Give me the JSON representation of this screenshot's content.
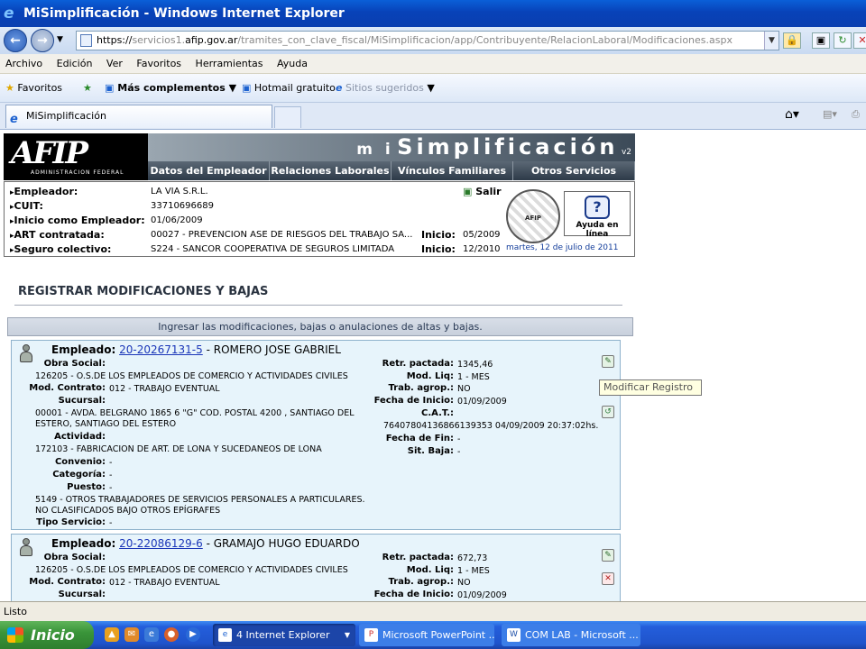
{
  "browser": {
    "title": "MiSimplificación - Windows Internet Explorer",
    "url_https": "https://",
    "url_host_pre": "servicios1.",
    "url_host": "afip.gov.ar",
    "url_path": "/tramites_con_clave_fiscal/MiSimplificacion/app/Contribuyente/RelacionLaboral/Modificaciones.aspx",
    "menu": [
      "Archivo",
      "Edición",
      "Ver",
      "Favoritos",
      "Herramientas",
      "Ayuda"
    ],
    "favorites": {
      "favoritos": "Favoritos",
      "mas": "Más complementos",
      "hotmail": "Hotmail gratuito",
      "sugeridos": "Sitios sugeridos"
    },
    "tab_label": "MiSimplificación",
    "status": "Listo"
  },
  "site": {
    "logo": "AFIP",
    "logo_sub": "ADMINISTRACION FEDERAL",
    "brand_mi": "m i",
    "brand_name": "Simplificación",
    "brand_version": "v2",
    "nav": [
      "Datos del Empleador",
      "Relaciones Laborales",
      "Vínculos Familiares",
      "Otros Servicios"
    ],
    "salir": "Salir",
    "ayuda": "Ayuda en línea",
    "seal_text": "AFIP",
    "date": "martes, 12 de julio de 2011"
  },
  "employer": {
    "rows": [
      {
        "label": "Empleador:",
        "value": "LA VIA S.R.L."
      },
      {
        "label": "CUIT:",
        "value": "33710696689"
      },
      {
        "label": "Inicio como Empleador:",
        "value": "01/06/2009"
      },
      {
        "label": "ART contratada:",
        "value": "00027 - PREVENCION ASE DE RIESGOS DEL TRABAJO SA...",
        "label2": "Inicio:",
        "value2": "05/2009"
      },
      {
        "label": "Seguro colectivo:",
        "value": "S224 - SANCOR COOPERATIVA DE SEGUROS LIMITADA",
        "label2": "Inicio:",
        "value2": "12/2010"
      }
    ]
  },
  "page": {
    "title": "REGISTRAR MODIFICACIONES Y BAJAS",
    "instructions": "Ingresar las modificaciones, bajas o anulaciones de altas y bajas.",
    "tooltip": "Modificar Registro"
  },
  "employees": [
    {
      "header_label": "Empleado:",
      "cuit": "20-20267131-5",
      "name": " - ROMERO JOSE GABRIEL",
      "obra_social_label": "Obra Social:",
      "obra_social": "126205 - O.S.DE LOS EMPLEADOS DE COMERCIO Y ACTIVIDADES CIVILES",
      "mod_contrato_label": "Mod. Contrato:",
      "mod_contrato": "012 - TRABAJO EVENTUAL",
      "sucursal_label": "Sucursal:",
      "sucursal_1": "00001 - AVDA. BELGRANO 1865 6 \"G\" COD. POSTAL 4200 , SANTIAGO DEL",
      "sucursal_2": "ESTERO, SANTIAGO DEL ESTERO",
      "actividad_label": "Actividad:",
      "actividad": "172103 - FABRICACION DE ART. DE LONA Y SUCEDANEOS DE LONA",
      "convenio_label": "Convenio:",
      "convenio": "-",
      "categoria_label": "Categoría:",
      "categoria": "-",
      "puesto_label": "Puesto:",
      "puesto": "-",
      "puesto_1": "5149 - OTROS TRABAJADORES DE SERVICIOS PERSONALES A PARTICULARES.",
      "puesto_2": "NO CLASIFICADOS BAJO OTROS EPÍGRAFES",
      "tipo_label": "Tipo Servicio:",
      "tipo": "-",
      "retr_label": "Retr. pactada:",
      "retr": "1345,46",
      "modliq_label": "Mod. Liq:",
      "modliq": "1 - MES",
      "trab_label": "Trab. agrop.:",
      "trab": "NO",
      "finicio_label": "Fecha de Inicio:",
      "finicio": "01/09/2009",
      "cat_label": "C.A.T.:",
      "cat": "76407804136866139353 04/09/2009 20:37:02hs.",
      "ffin_label": "Fecha de Fin:",
      "ffin": "-",
      "sitbaja_label": "Sit. Baja:",
      "sitbaja": "-"
    },
    {
      "header_label": "Empleado:",
      "cuit": "20-22086129-6",
      "name": " - GRAMAJO HUGO EDUARDO",
      "obra_social_label": "Obra Social:",
      "obra_social": "126205 - O.S.DE LOS EMPLEADOS DE COMERCIO Y ACTIVIDADES CIVILES",
      "mod_contrato_label": "Mod. Contrato:",
      "mod_contrato": "012 - TRABAJO EVENTUAL",
      "sucursal_label": "Sucursal:",
      "retr_label": "Retr. pactada:",
      "retr": "672,73",
      "modliq_label": "Mod. Liq:",
      "modliq": "1 - MES",
      "trab_label": "Trab. agrop.:",
      "trab": "NO",
      "finicio_label": "Fecha de Inicio:",
      "finicio": "01/09/2009"
    }
  ],
  "taskbar": {
    "start": "Inicio",
    "tasks": [
      "4 Internet Explorer",
      "Microsoft PowerPoint ...",
      "COM LAB - Microsoft ..."
    ]
  }
}
